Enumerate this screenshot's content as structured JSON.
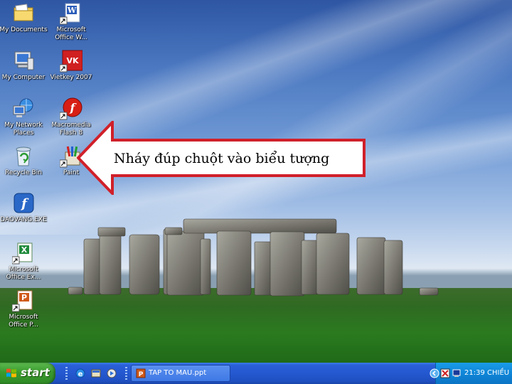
{
  "desktop": {
    "icons": [
      {
        "label": "My Documents",
        "icon": "my-documents-icon"
      },
      {
        "label": "Microsoft\nOffice W...",
        "icon": "word-icon"
      },
      {
        "label": "My Computer",
        "icon": "my-computer-icon"
      },
      {
        "label": "Vietkey 2007",
        "icon": "vietkey-icon"
      },
      {
        "label": "My Network\nPlaces",
        "icon": "network-places-icon"
      },
      {
        "label": "Macromedia\nFlash 8",
        "icon": "flash-icon"
      },
      {
        "label": "Recycle Bin",
        "icon": "recycle-bin-icon"
      },
      {
        "label": "Paint",
        "icon": "paint-icon"
      },
      {
        "label": "DAOVANG.EXE",
        "icon": "flash-player-icon"
      },
      {
        "label": "Microsoft\nOffice Ex...",
        "icon": "excel-icon"
      },
      {
        "label": "Microsoft\nOffice P...",
        "icon": "powerpoint-icon"
      }
    ]
  },
  "callout": {
    "text": "Nháy đúp chuột vào biểu tượng"
  },
  "taskbar": {
    "start_label": "start",
    "task_label": "TAP TO MAU.ppt",
    "clock": "21:39 CHIỀU"
  },
  "colors": {
    "taskbar_blue": "#2458d0",
    "start_green": "#3a9a2e",
    "callout_red": "#d0202a"
  }
}
